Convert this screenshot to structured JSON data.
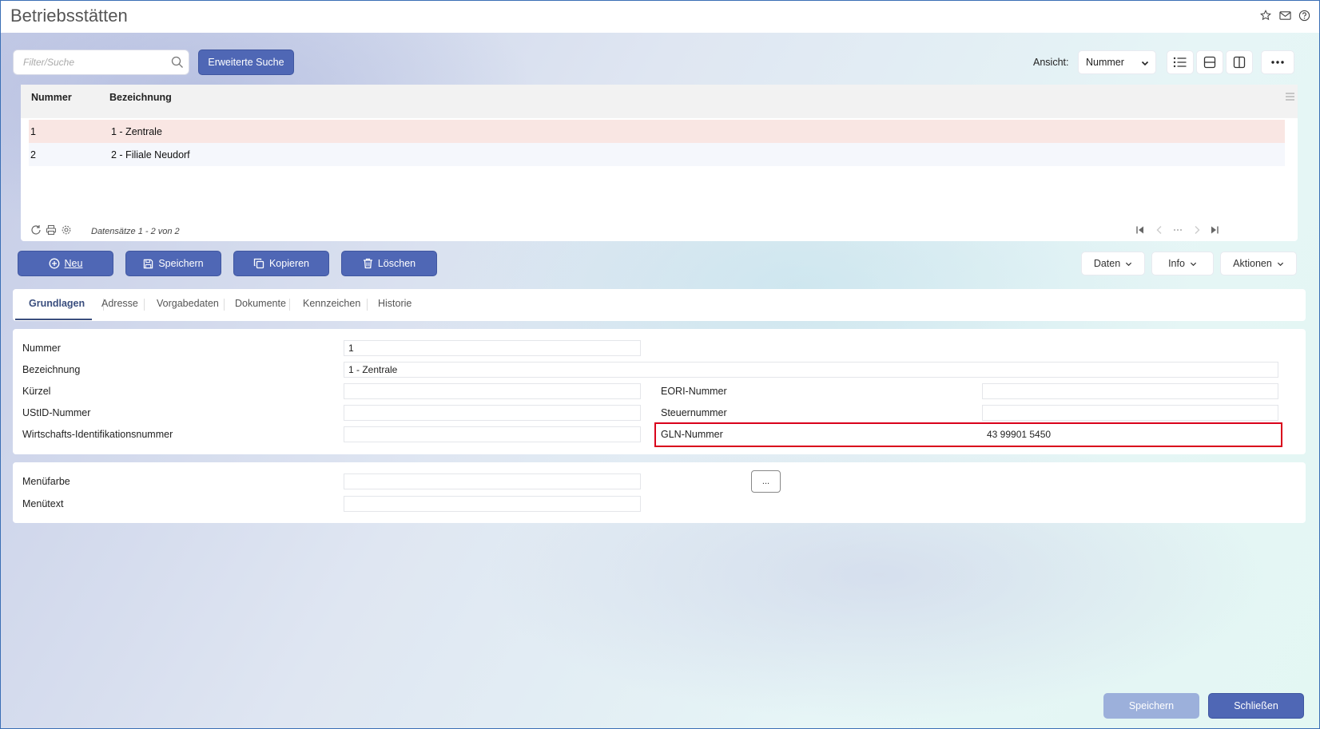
{
  "page": {
    "title": "Betriebsstätten"
  },
  "search": {
    "placeholder": "Filter/Suche",
    "advanced_label": "Erweiterte Suche"
  },
  "view": {
    "label": "Ansicht:",
    "selected": "Nummer"
  },
  "grid": {
    "columns": [
      "Nummer",
      "Bezeichnung"
    ],
    "rows": [
      {
        "nummer": "1",
        "bezeichnung": "1 - Zentrale",
        "selected": true
      },
      {
        "nummer": "2",
        "bezeichnung": "2 - Filiale Neudorf",
        "selected": false
      }
    ],
    "footer_text": "Datensätze 1 - 2 von 2"
  },
  "actions": {
    "new": "Neu",
    "save": "Speichern",
    "copy": "Kopieren",
    "delete": "Löschen",
    "data": "Daten",
    "info": "Info",
    "actions": "Aktionen"
  },
  "tabs": [
    "Grundlagen",
    "Adresse",
    "Vorgabedaten",
    "Dokumente",
    "Kennzeichen",
    "Historie"
  ],
  "form": {
    "nummer": {
      "label": "Nummer",
      "value": "1"
    },
    "bezeichnung": {
      "label": "Bezeichnung",
      "value": "1 - Zentrale"
    },
    "kuerzel": {
      "label": "Kürzel",
      "value": ""
    },
    "ustid": {
      "label": "UStID-Nummer",
      "value": ""
    },
    "wirtschafts_id": {
      "label": "Wirtschafts-Identifikationsnummer",
      "value": ""
    },
    "eori": {
      "label": "EORI-Nummer",
      "value": ""
    },
    "steuernummer": {
      "label": "Steuernummer",
      "value": ""
    },
    "gln": {
      "label": "GLN-Nummer",
      "value": "43 99901 5450"
    }
  },
  "menu": {
    "menufarbe": {
      "label": "Menüfarbe",
      "value": ""
    },
    "menutext": {
      "label": "Menütext",
      "value": ""
    },
    "ellipsis": "..."
  },
  "footer": {
    "save": "Speichern",
    "close": "Schließen"
  },
  "colors": {
    "primary": "#4f67b5",
    "disabled": "#9cb0db",
    "selected_row": "#f9e6e3",
    "alt_row": "#f5f7fc",
    "highlight_border": "#d9001b"
  }
}
